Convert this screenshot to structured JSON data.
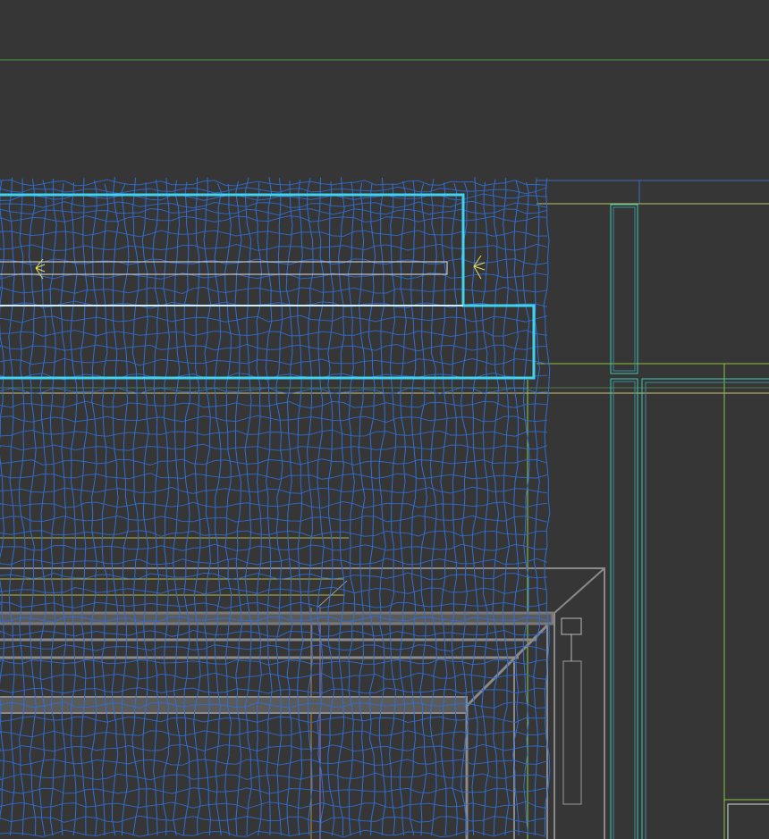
{
  "viewport": {
    "mode": "wireframe",
    "colors": {
      "background": "#363636",
      "curtain_mesh": "#2f6fd6",
      "selected_outline": "#3fd3f0",
      "guide_green": "#6fb03a",
      "guide_yellow": "#c8c860",
      "frame_cyan": "#3fc8b0",
      "furniture_gray": "#8a8a8a"
    }
  }
}
